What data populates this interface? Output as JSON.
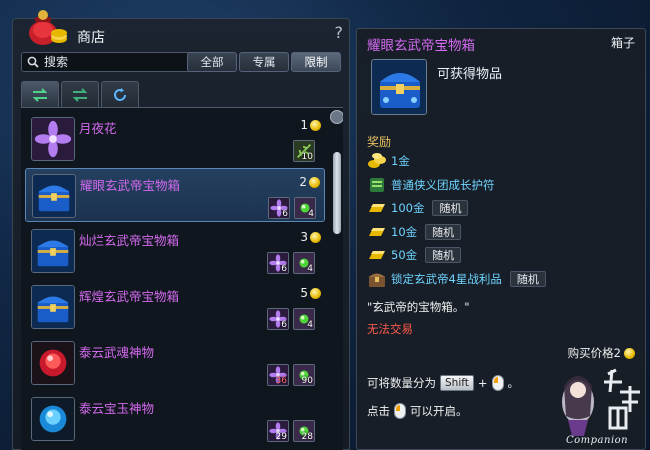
{
  "shop": {
    "title": "商店",
    "help": "?",
    "search_placeholder": "搜索",
    "filters": [
      "全部",
      "专属",
      "限制"
    ],
    "active_filter": "限制",
    "view_tabs": [
      "swap-icon",
      "swap-alt-icon",
      "refresh-icon"
    ]
  },
  "items": [
    {
      "name": "月夜花",
      "price": "1",
      "icon": "purple-flower-icon",
      "mats": [
        {
          "icon": "herb-icon",
          "qty": "10"
        }
      ]
    },
    {
      "name": "耀眼玄武帝宝物箱",
      "price": "2",
      "icon": "blue-chest-icon",
      "selected": true,
      "mats": [
        {
          "icon": "purple-flower-icon",
          "qty": "6"
        },
        {
          "icon": "green-gem-icon",
          "qty": "4"
        }
      ]
    },
    {
      "name": "灿烂玄武帝宝物箱",
      "price": "3",
      "icon": "blue-chest-icon",
      "mats": [
        {
          "icon": "purple-flower-icon",
          "qty": "6"
        },
        {
          "icon": "green-gem-icon",
          "qty": "4"
        }
      ]
    },
    {
      "name": "辉煌玄武帝宝物箱",
      "price": "5",
      "icon": "blue-chest-icon",
      "mats": [
        {
          "icon": "purple-flower-icon",
          "qty": "6"
        },
        {
          "icon": "green-gem-icon",
          "qty": "4"
        }
      ]
    },
    {
      "name": "泰云武魂神物",
      "price": "",
      "icon": "red-crystal-icon",
      "mats": [
        {
          "icon": "purple-flower-icon",
          "qty": "36",
          "red": true
        },
        {
          "icon": "green-gem-icon",
          "qty": "90"
        }
      ]
    },
    {
      "name": "泰云宝玉神物",
      "price": "",
      "icon": "blue-crystal-icon",
      "mats": [
        {
          "icon": "purple-flower-icon",
          "qty": "29"
        },
        {
          "icon": "green-gem-icon",
          "qty": "28"
        }
      ]
    }
  ],
  "detail": {
    "title": "耀眼玄武帝宝物箱",
    "type": "箱子",
    "obtain": "可获得物品",
    "reward_title": "奖励",
    "rewards": [
      {
        "icon": "gold-ingots-icon",
        "text": "1金",
        "random": ""
      },
      {
        "icon": "scroll-icon",
        "text": "普通侠义团成长护符",
        "random": ""
      },
      {
        "icon": "gold-bar-icon",
        "text": "100金",
        "random": "随机"
      },
      {
        "icon": "gold-bar-icon",
        "text": "10金",
        "random": "随机"
      },
      {
        "icon": "gold-bar-icon",
        "text": "50金",
        "random": "随机"
      },
      {
        "icon": "treasure-chest-icon",
        "text": "锁定玄武帝4星战利品",
        "random": "随机"
      }
    ],
    "description": "\"玄武帝的宝物箱。\"",
    "trade": "无法交易",
    "price_label": "购买价格2",
    "split_prefix": "可将数量分为",
    "split_key": "Shift",
    "split_plus": "+",
    "split_suffix": "。",
    "open_prefix": "点击",
    "open_suffix": "可以开启。"
  },
  "watermark": {
    "text": "Companion",
    "glyphs": "攻略組"
  },
  "colors": {
    "item_name": "#d46af0",
    "reward_text": "#6fd4ff",
    "trade_warning": "#ff5a4a",
    "reward_heading": "#e8c060"
  }
}
